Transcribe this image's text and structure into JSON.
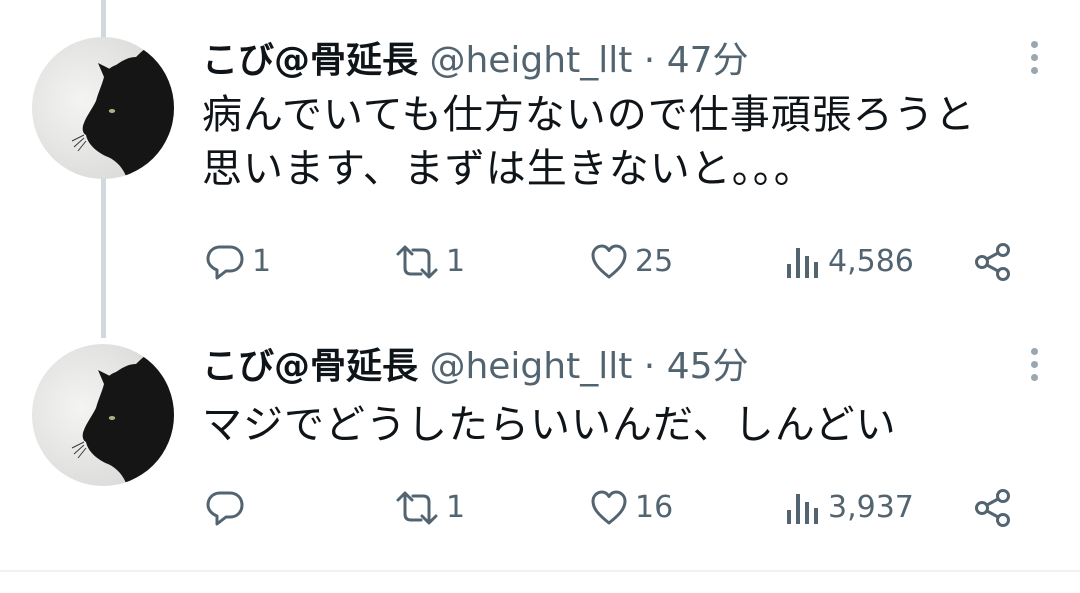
{
  "tweets": [
    {
      "author_name": "こび@骨延長",
      "handle": "@height_llt",
      "separator": "·",
      "time": "47分",
      "text_lines": [
        "病んでいても仕方ないので仕事頑張ろうと",
        "思います、まずは生きないと。。。"
      ],
      "replies": "1",
      "retweets": "1",
      "likes": "25",
      "views": "4,586"
    },
    {
      "author_name": "こび@骨延長",
      "handle": "@height_llt",
      "separator": "·",
      "time": "45分",
      "text_lines": [
        "マジでどうしたらいいんだ、しんどい"
      ],
      "replies": "",
      "retweets": "1",
      "likes": "16",
      "views": "3,937"
    }
  ],
  "icons": {
    "reply": "reply-icon",
    "retweet": "retweet-icon",
    "like": "heart-icon",
    "views": "views-icon",
    "share": "share-icon",
    "more": "more-icon"
  },
  "colors": {
    "text": "#0f1419",
    "muted": "#536471",
    "thread_line": "#cfd9de",
    "divider": "#eff3f4"
  }
}
